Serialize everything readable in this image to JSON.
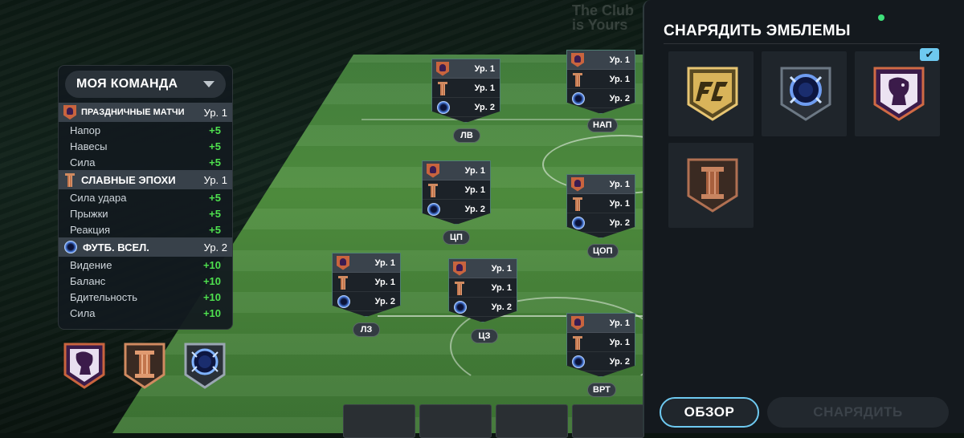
{
  "background": {
    "watermark_text": [
      "The Club",
      "is Yours"
    ]
  },
  "team_panel": {
    "selector_label": "МОЯ КОМАНДА",
    "categories": [
      {
        "icon": "premier-league-icon",
        "title": "ПРАЗДНИЧНЫЕ МАТЧИ",
        "level": "Ур. 1",
        "stats": [
          {
            "name": "Напор",
            "value": "+5"
          },
          {
            "name": "Навесы",
            "value": "+5"
          },
          {
            "name": "Сила",
            "value": "+5"
          }
        ]
      },
      {
        "icon": "column-icon",
        "title": "СЛАВНЫЕ ЭПОХИ",
        "level": "Ур. 1",
        "stats": [
          {
            "name": "Сила удара",
            "value": "+5"
          },
          {
            "name": "Прыжки",
            "value": "+5"
          },
          {
            "name": "Реакция",
            "value": "+5"
          }
        ]
      },
      {
        "icon": "football-universe-icon",
        "title": "ФУТБ. ВСЕЛ.",
        "level": "Ур. 2",
        "stats": [
          {
            "name": "Видение",
            "value": "+10"
          },
          {
            "name": "Баланс",
            "value": "+10"
          },
          {
            "name": "Бдительность",
            "value": "+10"
          },
          {
            "name": "Сила",
            "value": "+10"
          }
        ]
      }
    ]
  },
  "players": [
    {
      "position": "ЛВ",
      "levels": [
        "Ур. 1",
        "Ур. 1",
        "Ур. 2"
      ]
    },
    {
      "position": "НАП",
      "levels": [
        "Ур. 1",
        "Ур. 1",
        "Ур. 2"
      ]
    },
    {
      "position": "ЦП",
      "levels": [
        "Ур. 1",
        "Ур. 1",
        "Ур. 2"
      ]
    },
    {
      "position": "ЦОП",
      "levels": [
        "Ур. 1",
        "Ур. 1",
        "Ур. 2"
      ]
    },
    {
      "position": "ЛЗ",
      "levels": [
        "Ур. 1",
        "Ур. 1",
        "Ур. 2"
      ]
    },
    {
      "position": "ЦЗ",
      "levels": [
        "Ур. 1",
        "Ур. 1",
        "Ур. 2"
      ]
    },
    {
      "position": "ВРТ",
      "levels": [
        "Ур. 1",
        "Ур. 1",
        "Ур. 2"
      ]
    }
  ],
  "equip_panel": {
    "title": "СНАРЯДИТЬ ЭМБЛЕМЫ",
    "emblems": [
      "fc-logo-icon",
      "football-universe-icon",
      "premier-league-icon",
      "column-icon"
    ],
    "selected_check": "✔",
    "review_button": "ОБЗОР",
    "equip_button": "СНАРЯДИТЬ"
  },
  "colors": {
    "accent": "#6ec9f0",
    "positive": "#4ee04e",
    "status_dot": "#3ee07a"
  }
}
